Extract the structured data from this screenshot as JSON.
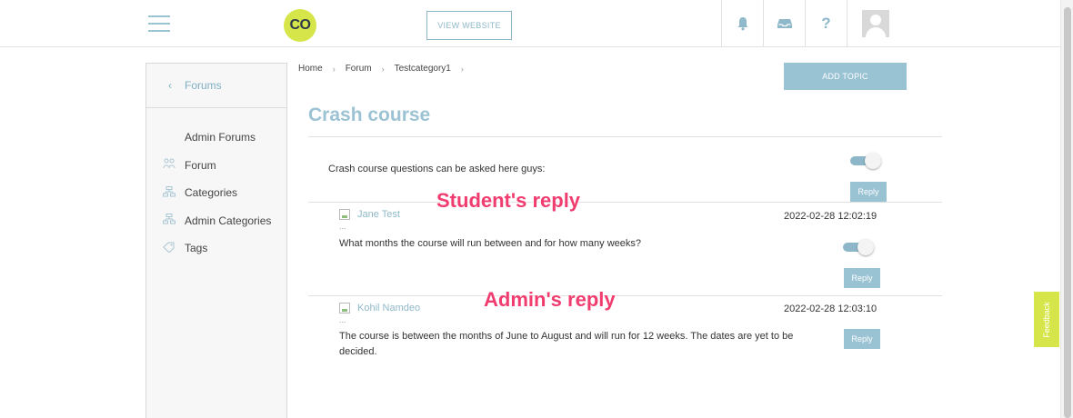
{
  "header": {
    "logo_text": "CO",
    "view_website_label": "VIEW WEBSITE",
    "help_glyph": "?",
    "icons": [
      "hamburger-menu-icon",
      "bell-icon",
      "inbox-icon",
      "help-icon",
      "user-avatar-icon"
    ]
  },
  "sidebar": {
    "back_label": "Forums",
    "items": [
      {
        "label": "Admin Forums",
        "icon": ""
      },
      {
        "label": "Forum",
        "icon": "forum-icon"
      },
      {
        "label": "Categories",
        "icon": "categories-icon"
      },
      {
        "label": "Admin Categories",
        "icon": "admin-categories-icon"
      },
      {
        "label": "Tags",
        "icon": "tag-icon"
      }
    ]
  },
  "breadcrumb": [
    "Home",
    "Forum",
    "Testcategory1"
  ],
  "main": {
    "add_topic_label": "ADD TOPIC",
    "title": "Crash course",
    "topic_text": "Crash course questions can be asked here guys:",
    "reply_label": "Reply",
    "replies": [
      {
        "author": "Jane Test",
        "timestamp": "2022-02-28 12:02:19",
        "text": "What months the course will run between and for how many weeks?",
        "dots": "..."
      },
      {
        "author": "Kohil Namdeo",
        "timestamp": "2022-02-28 12:03:10",
        "text": "The course is between the months of June to August and will run for 12 weeks. The dates are yet to be decided.",
        "dots": "..."
      }
    ]
  },
  "annotations": {
    "student": "Student's reply",
    "admin": "Admin's reply"
  },
  "feedback_label": "Feedback",
  "colors": {
    "accent": "#99c2d3",
    "logo": "#d6e64a",
    "annotation": "#f03c6e"
  }
}
